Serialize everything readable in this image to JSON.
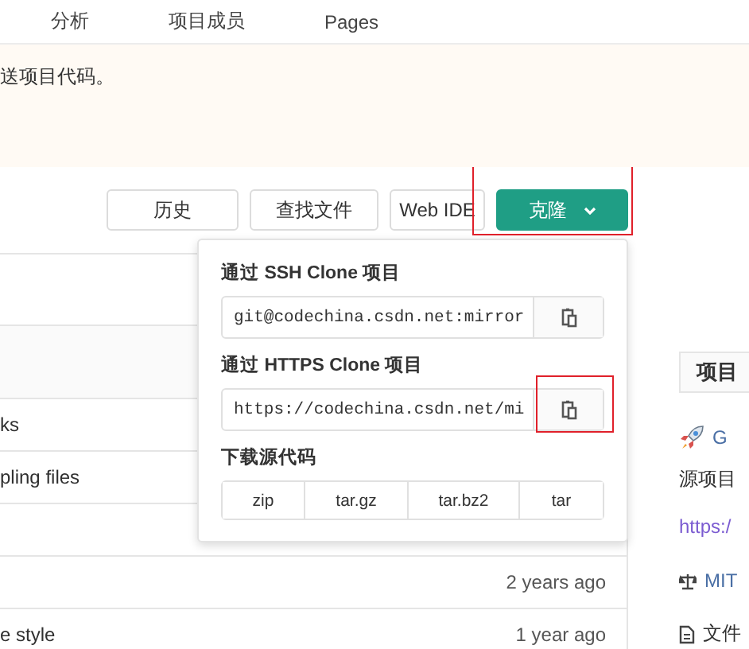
{
  "nav": {
    "items": [
      {
        "label": "分析"
      },
      {
        "label": "项目成员"
      },
      {
        "label": "Pages"
      }
    ]
  },
  "banner": {
    "text": "送项目代码。"
  },
  "toolbar": {
    "buttons": [
      {
        "label": "历史",
        "kind": "default"
      },
      {
        "label": "查找文件",
        "kind": "default"
      },
      {
        "label": "Web IDE",
        "kind": "default"
      },
      {
        "label": "克隆",
        "kind": "primary"
      }
    ]
  },
  "file_list": {
    "rows": [
      {
        "selected": false
      },
      {
        "selected": true
      },
      {
        "selected": false,
        "name": "ks"
      },
      {
        "selected": false,
        "name": "pling files"
      },
      {
        "selected": false
      },
      {
        "selected": false,
        "time": "2 years ago"
      },
      {
        "selected": false,
        "name": "e style",
        "time": "1 year ago"
      }
    ]
  },
  "clone_menu": {
    "sections": [
      {
        "kind": "url",
        "title": "通过 SSH Clone 项目",
        "value": "git@codechina.csdn.net:mirror"
      },
      {
        "kind": "url",
        "title": "通过 HTTPS Clone 项目",
        "value": "https://codechina.csdn.net/mi"
      },
      {
        "kind": "download",
        "title": "下载源代码",
        "formats": [
          "zip",
          "tar.gz",
          "tar.bz2",
          "tar"
        ]
      }
    ]
  },
  "sidebar": {
    "title": "项目",
    "items": [
      {
        "kind": "rocket",
        "text": "G"
      },
      {
        "kind": "text",
        "text": "源项目"
      },
      {
        "kind": "url",
        "text": "https:/"
      },
      {
        "kind": "license",
        "text": "MIT"
      },
      {
        "kind": "file",
        "text": "文件"
      }
    ]
  }
}
